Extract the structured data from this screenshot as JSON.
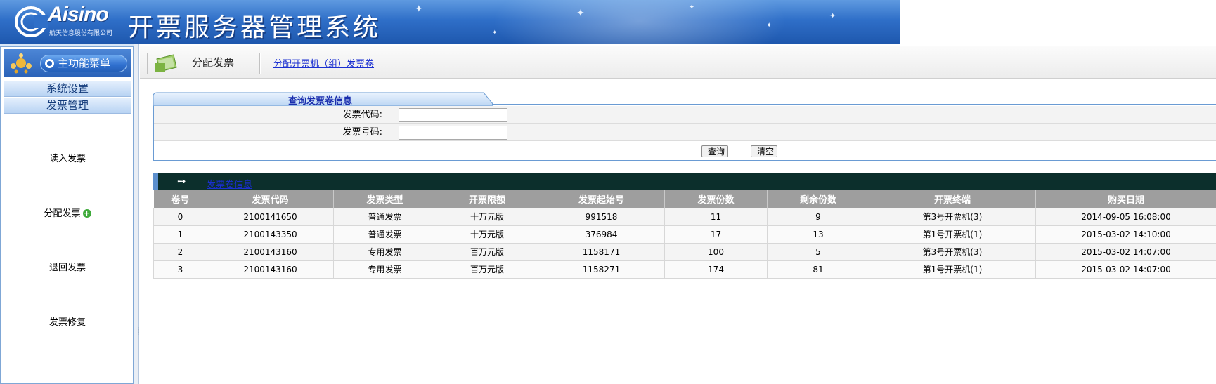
{
  "header": {
    "logo_text": "Aisino",
    "logo_subtitle": "航天信息股份有限公司",
    "system_title": "开票服务器管理系统"
  },
  "sidebar": {
    "main_menu_label": "主功能菜单",
    "sections": [
      {
        "label": "系统设置"
      },
      {
        "label": "发票管理"
      }
    ],
    "items": [
      {
        "label": "读入发票"
      },
      {
        "label": "分配发票"
      },
      {
        "label": "退回发票"
      },
      {
        "label": "发票修复"
      }
    ]
  },
  "toolbar": {
    "title": "分配发票",
    "link": "分配开票机（组）发票卷"
  },
  "query": {
    "tab_title": "查询发票卷信息",
    "fields": [
      {
        "label": "发票代码:",
        "value": ""
      },
      {
        "label": "发票号码:",
        "value": ""
      }
    ],
    "search_button": "查询",
    "clear_button": "清空"
  },
  "results": {
    "title": "发票卷信息",
    "columns": [
      "卷号",
      "发票代码",
      "发票类型",
      "开票限额",
      "发票起始号",
      "发票份数",
      "剩余份数",
      "开票终端",
      "购买日期"
    ],
    "rows": [
      [
        "0",
        "2100141650",
        "普通发票",
        "十万元版",
        "991518",
        "11",
        "9",
        "第3号开票机(3)",
        "2014-09-05 16:08:00"
      ],
      [
        "1",
        "2100143350",
        "普通发票",
        "十万元版",
        "376984",
        "17",
        "13",
        "第1号开票机(1)",
        "2015-03-02 14:10:00"
      ],
      [
        "2",
        "2100143160",
        "专用发票",
        "百万元版",
        "1158171",
        "100",
        "5",
        "第3号开票机(3)",
        "2015-03-02 14:07:00"
      ],
      [
        "3",
        "2100143160",
        "专用发票",
        "百万元版",
        "1158271",
        "174",
        "81",
        "第1号开票机(1)",
        "2015-03-02 14:07:00"
      ]
    ]
  },
  "colors": {
    "banner": "#2f6fc8",
    "link": "#1a2fd1",
    "table_header": "#9e9e9e",
    "result_bar": "#0c2f2c"
  }
}
